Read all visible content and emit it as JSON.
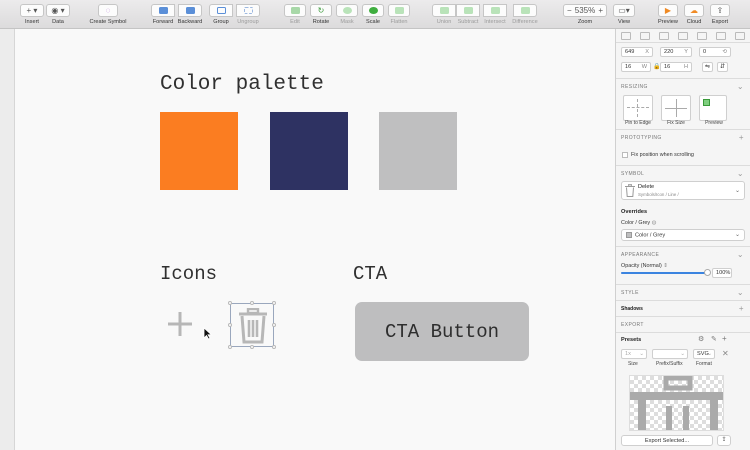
{
  "toolbar": {
    "insert": "Insert",
    "data": "Data",
    "create_symbol": "Create Symbol",
    "forward": "Forward",
    "backward": "Backward",
    "group": "Group",
    "ungroup": "Ungroup",
    "edit": "Edit",
    "rotate": "Rotate",
    "mask": "Mask",
    "scale": "Scale",
    "flatten": "Flatten",
    "union": "Union",
    "subtract": "Subtract",
    "intersect": "Intersect",
    "difference": "Difference",
    "zoom_value": "535%",
    "zoom": "Zoom",
    "view": "View",
    "preview": "Preview",
    "cloud": "Cloud",
    "export": "Export"
  },
  "canvas": {
    "palette_title": "Color palette",
    "swatch_colors": [
      "#fb7d21",
      "#2e3262",
      "#bfbfc0"
    ],
    "icons_title": "Icons",
    "cta_title": "CTA",
    "cta_button": "CTA Button"
  },
  "inspector": {
    "x": "649",
    "y": "220",
    "rotation": "0",
    "w": "16",
    "h": "16",
    "w_label": "W",
    "h_label": "H",
    "resizing": "RESIZING",
    "pin_to_edge": "Pin to Edge",
    "fix_size": "Fix Size",
    "preview": "Preview",
    "prototyping": "PROTOTYPING",
    "fix_position": "Fix position when scrolling",
    "symbol": "SYMBOL",
    "symbol_name": "Delete",
    "symbol_path": "Symbols/Icon / Line /",
    "overrides": "Overrides",
    "color_grey_label": "Color / Grey",
    "color_grey_value": "Color / Grey",
    "appearance": "APPEARANCE",
    "opacity_label": "Opacity (Normal)",
    "opacity_value": "100%",
    "opacity_fraction": 1.0,
    "style": "STYLE",
    "shadows": "Shadows",
    "export": "EXPORT",
    "presets": "Presets",
    "size_value": "1x",
    "size_label": "Size",
    "prefix_label": "Prefix/Suffix",
    "format_value": "SVG",
    "format_label": "Format",
    "export_selected": "Export Selected..."
  }
}
